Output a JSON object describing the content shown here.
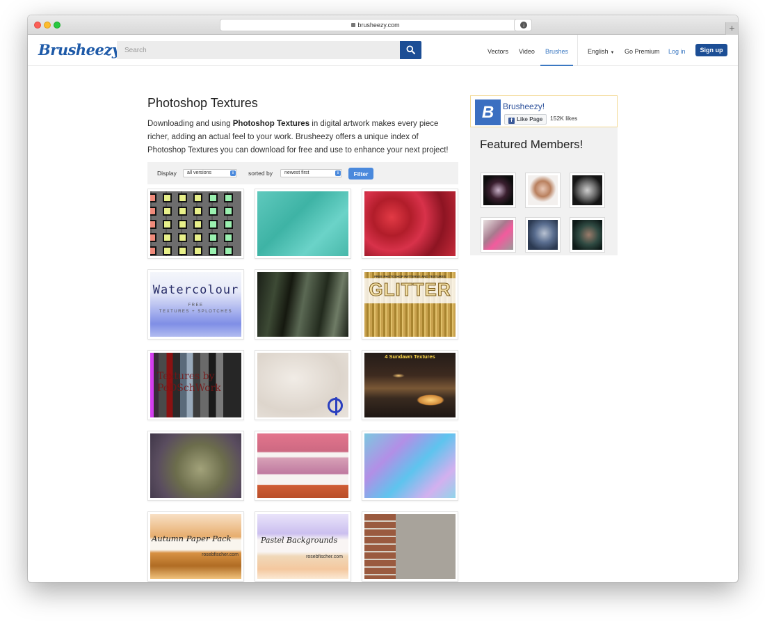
{
  "browser": {
    "url": "brusheezy.com",
    "newtab_label": "+"
  },
  "header": {
    "logo": "Brusheezy",
    "search_placeholder": "Search",
    "nav": {
      "vectors": "Vectors",
      "video": "Video",
      "brushes": "Brushes",
      "language": "English",
      "premium": "Go Premium",
      "login": "Log in",
      "signup": "Sign up"
    }
  },
  "main": {
    "title": "Photoshop Textures",
    "intro_before": "Downloading and using ",
    "intro_bold": "Photoshop Textures",
    "intro_after": " in digital artwork makes every piece richer, adding an actual feel to your work. Brusheezy offers a unique index of Photoshop Textures you can download for free and use to enhance your next project!",
    "filter": {
      "display_label": "Display",
      "display_value": "all versions",
      "sort_label": "sorted by",
      "sort_value": "newest first",
      "button": "Filter"
    }
  },
  "tiles": {
    "watercolour_title": "Watercolour",
    "watercolour_sub1": "FREE",
    "watercolour_sub2": "TEXTURES + SPLOTCHES",
    "glitter_sub": "FREE PHOTOSHOP PATTERNS AND TEXTURES",
    "glitter_title": "GLITTER",
    "pd_title": "Textures by PeDSchWork",
    "sundawn_title": "4  Sundawn Textures",
    "autumn_title": "Autumn Paper Pack",
    "autumn_credit": "rosebfischer.com",
    "pastel_title": "Pastel Backgrounds",
    "pastel_credit": "rosebfischer.com"
  },
  "sidebar": {
    "fb_logo": "B",
    "fb_name": "Brusheezy!",
    "fb_like": "Like Page",
    "fb_likes": "152K likes",
    "featured_title": "Featured Members!"
  },
  "colors": {
    "brand": "#1c4e95",
    "link": "#3b78c2",
    "filter_button": "#4a89dc"
  }
}
